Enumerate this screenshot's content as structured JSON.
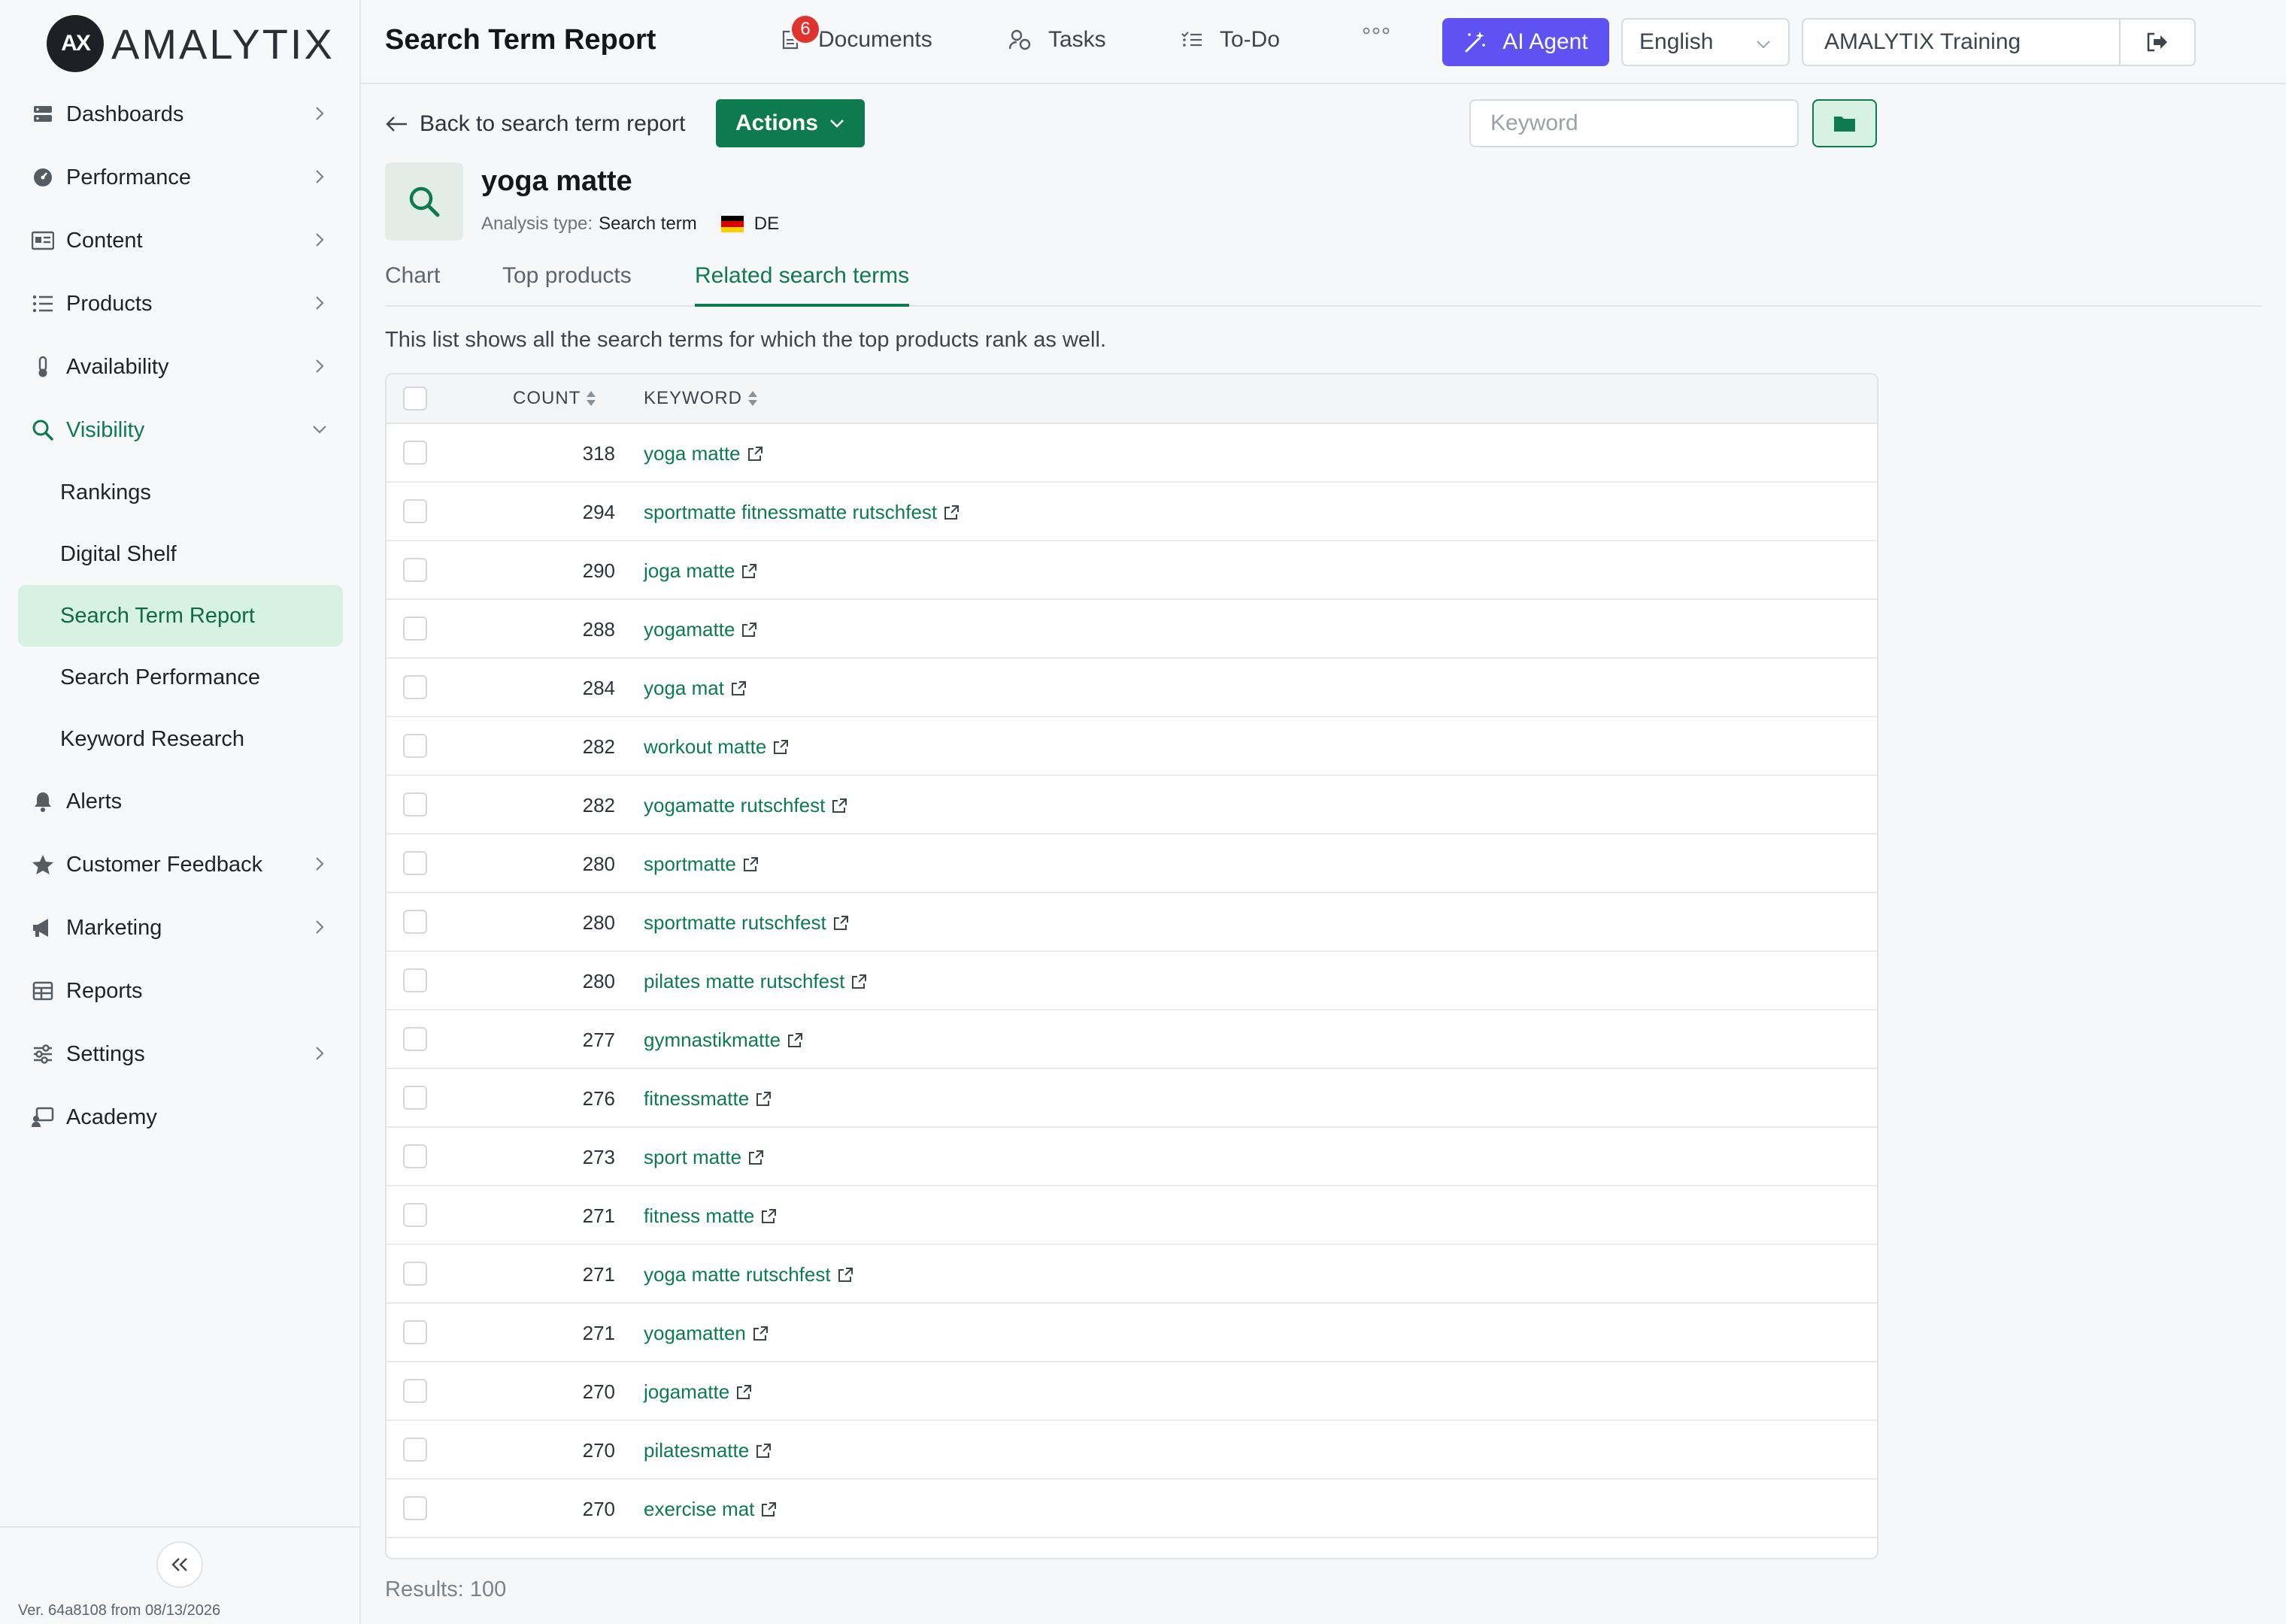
{
  "brand": {
    "name": "AMALYTIX",
    "mark": "AX"
  },
  "sidebar": {
    "items": [
      {
        "label": "Dashboards",
        "icon": "dashboard-icon"
      },
      {
        "label": "Performance",
        "icon": "gauge-icon"
      },
      {
        "label": "Content",
        "icon": "content-icon"
      },
      {
        "label": "Products",
        "icon": "list-icon"
      },
      {
        "label": "Availability",
        "icon": "thermometer-icon"
      },
      {
        "label": "Visibility",
        "icon": "search-icon"
      },
      {
        "label": "Alerts",
        "icon": "bell-icon"
      },
      {
        "label": "Customer Feedback",
        "icon": "star-icon"
      },
      {
        "label": "Marketing",
        "icon": "megaphone-icon"
      },
      {
        "label": "Reports",
        "icon": "table-icon"
      },
      {
        "label": "Settings",
        "icon": "sliders-icon"
      },
      {
        "label": "Academy",
        "icon": "academy-icon"
      }
    ],
    "visibility_sub": [
      "Rankings",
      "Digital Shelf",
      "Search Term Report",
      "Search Performance",
      "Keyword Research"
    ],
    "version": "Ver. 64a8108 from 08/13/2026"
  },
  "topbar": {
    "title": "Search Term Report",
    "documents": "Documents",
    "documents_badge": "6",
    "tasks": "Tasks",
    "todo": "To-Do",
    "ai_agent": "AI Agent",
    "language": "English",
    "account": "AMALYTIX Training"
  },
  "subheader": {
    "back": "Back to search term report",
    "actions": "Actions",
    "keyword_placeholder": "Keyword"
  },
  "term": {
    "name": "yoga matte",
    "analysis_label": "Analysis type:",
    "analysis_value": "Search term",
    "marketplace": "DE"
  },
  "tabs": [
    "Chart",
    "Top products",
    "Related search terms"
  ],
  "intro": "This list shows all the search terms for which the top products rank as well.",
  "table": {
    "columns": [
      "COUNT",
      "KEYWORD"
    ],
    "rows": [
      {
        "count": "318",
        "keyword": "yoga matte"
      },
      {
        "count": "294",
        "keyword": "sportmatte fitnessmatte rutschfest"
      },
      {
        "count": "290",
        "keyword": "joga matte"
      },
      {
        "count": "288",
        "keyword": "yogamatte"
      },
      {
        "count": "284",
        "keyword": "yoga mat"
      },
      {
        "count": "282",
        "keyword": "workout matte"
      },
      {
        "count": "282",
        "keyword": "yogamatte rutschfest"
      },
      {
        "count": "280",
        "keyword": "sportmatte"
      },
      {
        "count": "280",
        "keyword": "sportmatte rutschfest"
      },
      {
        "count": "280",
        "keyword": "pilates matte rutschfest"
      },
      {
        "count": "277",
        "keyword": "gymnastikmatte"
      },
      {
        "count": "276",
        "keyword": "fitnessmatte"
      },
      {
        "count": "273",
        "keyword": "sport matte"
      },
      {
        "count": "271",
        "keyword": "fitness matte"
      },
      {
        "count": "271",
        "keyword": "yoga matte rutschfest"
      },
      {
        "count": "271",
        "keyword": "yogamatten"
      },
      {
        "count": "270",
        "keyword": "jogamatte"
      },
      {
        "count": "270",
        "keyword": "pilatesmatte"
      },
      {
        "count": "270",
        "keyword": "exercise mat"
      }
    ]
  },
  "results": "Results: 100",
  "colors": {
    "accent": "#0e7a4f",
    "ai": "#5f52f2",
    "badge": "#e0332e"
  }
}
